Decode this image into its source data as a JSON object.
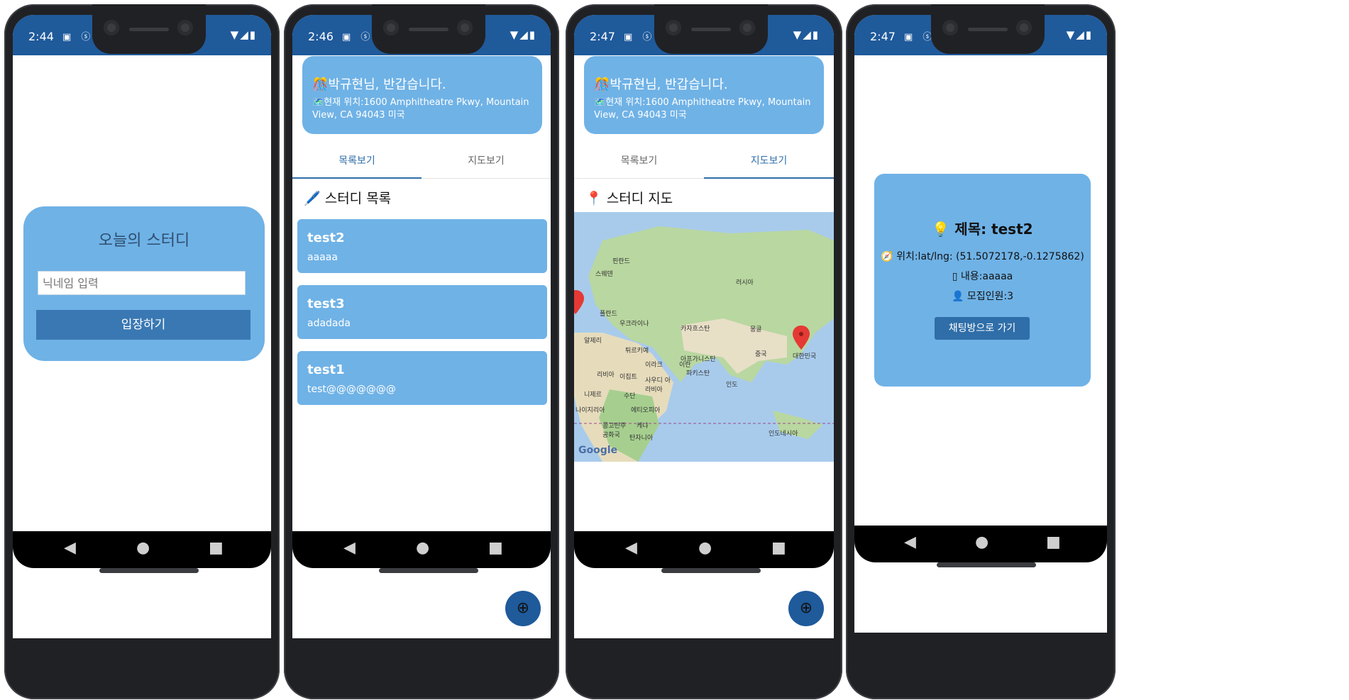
{
  "screens": [
    {
      "time": "2:44",
      "login": {
        "title": "오늘의 스터디",
        "nickname_placeholder": "닉네임 입력",
        "enter_label": "입장하기"
      }
    },
    {
      "time": "2:46",
      "header": {
        "greeting": "박규현님, 반갑습니다.",
        "location": "현재 위치:1600 Amphitheatre Pkwy, Mountain View, CA 94043 미국"
      },
      "tabs": [
        "목록보기",
        "지도보기"
      ],
      "section_title": "스터디 목록",
      "studies": [
        {
          "title": "test2",
          "desc": "aaaaa"
        },
        {
          "title": "test3",
          "desc": "adadada"
        },
        {
          "title": "test1",
          "desc": "test@@@@@@@"
        }
      ],
      "fab_label": "⊕"
    },
    {
      "time": "2:47",
      "header": {
        "greeting": "박규현님, 반갑습니다.",
        "location": "현재 위치:1600 Amphitheatre Pkwy, Mountain View, CA 94043 미국"
      },
      "tabs": [
        "목록보기",
        "지도보기"
      ],
      "section_title": "스터디 지도",
      "map_labels": [
        "러시아",
        "카자흐스탄",
        "몽골",
        "중국",
        "대한민국",
        "인도",
        "이란",
        "이라크",
        "튀르키예",
        "이집트",
        "사우디 아라비아",
        "아프가니스탄",
        "파키스탄",
        "수단",
        "에티오피아",
        "케냐",
        "탄자니아",
        "인도네시아",
        "우크라이나",
        "스웨덴",
        "폴란드",
        "핀란드",
        "나이지리아",
        "니제르",
        "리비아",
        "알제리",
        "콩고민주 공화국"
      ],
      "map_brand": "Google",
      "fab_label": "⊕"
    },
    {
      "time": "2:47",
      "detail": {
        "title": "제목: test2",
        "location": "위치:lat/lng: (51.5072178,-0.1275862)",
        "content": "내용:aaaaa",
        "members": "모집인원:3",
        "chat_label": "채팅방으로 가기"
      }
    }
  ],
  "nav": {
    "back": "◀",
    "home": "●",
    "recent": "■"
  },
  "colors": {
    "status_bar": "#1f5a9b",
    "card": "#6fb2e6",
    "button": "#3a78b3",
    "tab_active": "#2f6ea8"
  }
}
